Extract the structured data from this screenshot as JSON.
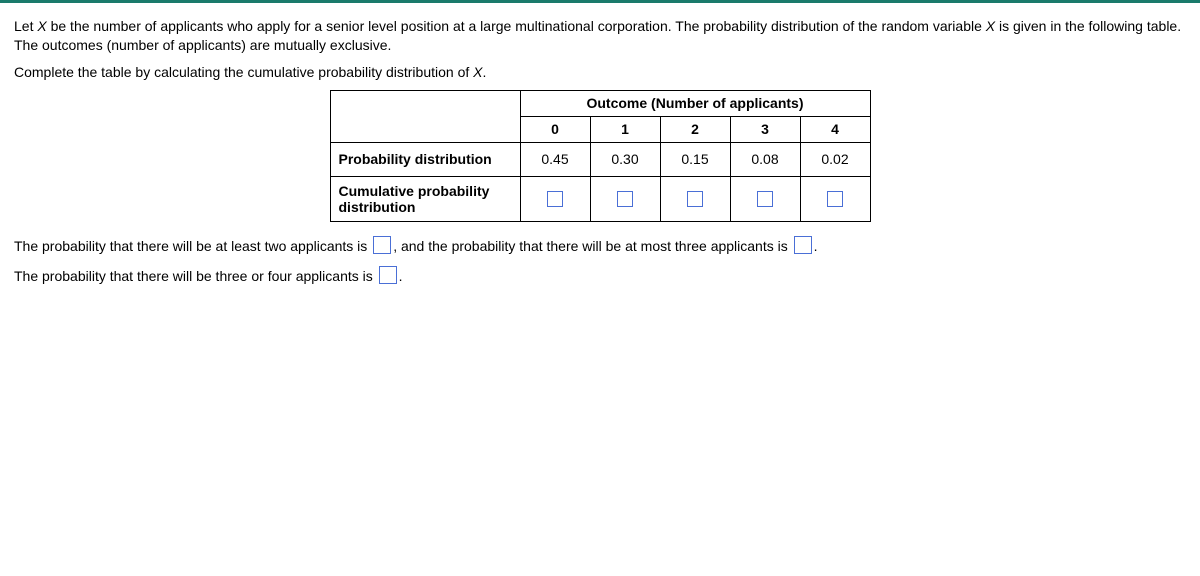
{
  "prompt": {
    "p1_a": "Let ",
    "p1_var": "X",
    "p1_b": " be the number of applicants who apply for a senior level position at a large multinational corporation. The probability distribution of the random variable ",
    "p1_var2": "X",
    "p1_c": " is given in the following table. The outcomes (number of applicants) are mutually exclusive.",
    "p2_a": "Complete the table by calculating the cumulative probability distribution of ",
    "p2_var": "X",
    "p2_b": "."
  },
  "table": {
    "super_header": "Outcome (Number of applicants)",
    "cols": [
      "0",
      "1",
      "2",
      "3",
      "4"
    ],
    "row_prob_label": "Probability distribution",
    "row_prob_vals": [
      "0.45",
      "0.30",
      "0.15",
      "0.08",
      "0.02"
    ],
    "row_cum_label": "Cumulative probability distribution"
  },
  "answers": {
    "line1_a": "The probability that there will be at least two applicants is ",
    "line1_b": ", and the probability that there will be at most three applicants is ",
    "line1_c": ".",
    "line2_a": "The probability that there will be three or four applicants is ",
    "line2_b": "."
  },
  "chart_data": {
    "type": "table",
    "title": "Outcome (Number of applicants)",
    "categories": [
      "0",
      "1",
      "2",
      "3",
      "4"
    ],
    "series": [
      {
        "name": "Probability distribution",
        "values": [
          0.45,
          0.3,
          0.15,
          0.08,
          0.02
        ]
      },
      {
        "name": "Cumulative probability distribution",
        "values": [
          null,
          null,
          null,
          null,
          null
        ]
      }
    ]
  }
}
